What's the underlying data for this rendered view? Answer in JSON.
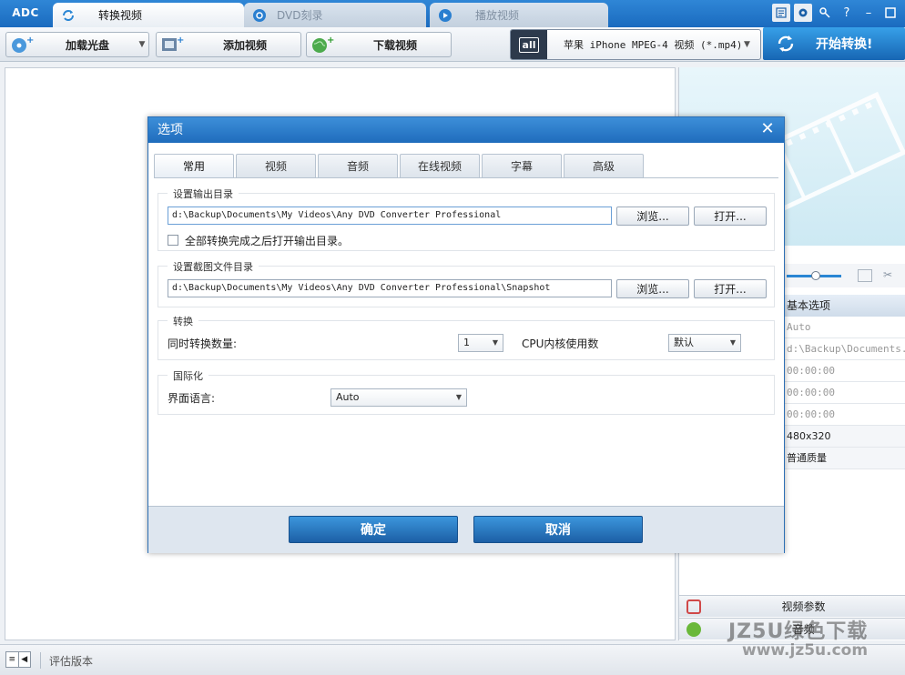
{
  "app": {
    "logo": "ADC",
    "tabs": [
      {
        "label": "转换视频",
        "state": "active"
      },
      {
        "label": "DVD刻录",
        "state": "inactive"
      },
      {
        "label": "播放视频",
        "state": "inactive"
      }
    ],
    "window_buttons": [
      "layout-icon",
      "settings-icon",
      "key-icon",
      "help-icon",
      "minimize-icon",
      "close-icon"
    ]
  },
  "toolbar": {
    "load_disc": "加载光盘",
    "add_video": "添加视频",
    "download_video": "下载视频",
    "format_badge": "all",
    "format": "苹果 iPhone MPEG-4 视频 (*.mp4)",
    "convert": "开始转换!"
  },
  "properties": {
    "header": "基本选项",
    "rows": [
      "Auto",
      "d:\\Backup\\Documents...",
      "00:00:00",
      "00:00:00",
      "00:00:00",
      "480x320",
      "普通质量"
    ],
    "video_params": "视频参数",
    "audio": "音频"
  },
  "status": {
    "text": "评估版本",
    "watermark": "JZ5U绿色下载",
    "watermark_url": "www.jz5u.com"
  },
  "dialog": {
    "title": "选项",
    "tabs": [
      {
        "label": "常用",
        "active": true
      },
      {
        "label": "视频",
        "active": false
      },
      {
        "label": "音频",
        "active": false
      },
      {
        "label": "在线视频",
        "active": false
      },
      {
        "label": "字幕",
        "active": false
      },
      {
        "label": "高级",
        "active": false
      }
    ],
    "output": {
      "title": "设置输出目录",
      "path": "d:\\Backup\\Documents\\My Videos\\Any DVD Converter Professional",
      "browse": "浏览...",
      "open": "打开...",
      "open_after": "全部转换完成之后打开输出目录。",
      "open_after_checked": false
    },
    "snapshot": {
      "title": "设置截图文件目录",
      "path": "d:\\Backup\\Documents\\My Videos\\Any DVD Converter Professional\\Snapshot",
      "browse": "浏览...",
      "open": "打开..."
    },
    "convert": {
      "title": "转换",
      "concurrent_label": "同时转换数量:",
      "concurrent_value": "1",
      "cpu_label": "CPU内核使用数",
      "cpu_value": "默认"
    },
    "i18n": {
      "title": "国际化",
      "lang_label": "界面语言:",
      "lang_value": "Auto"
    },
    "ok": "确定",
    "cancel": "取消"
  }
}
